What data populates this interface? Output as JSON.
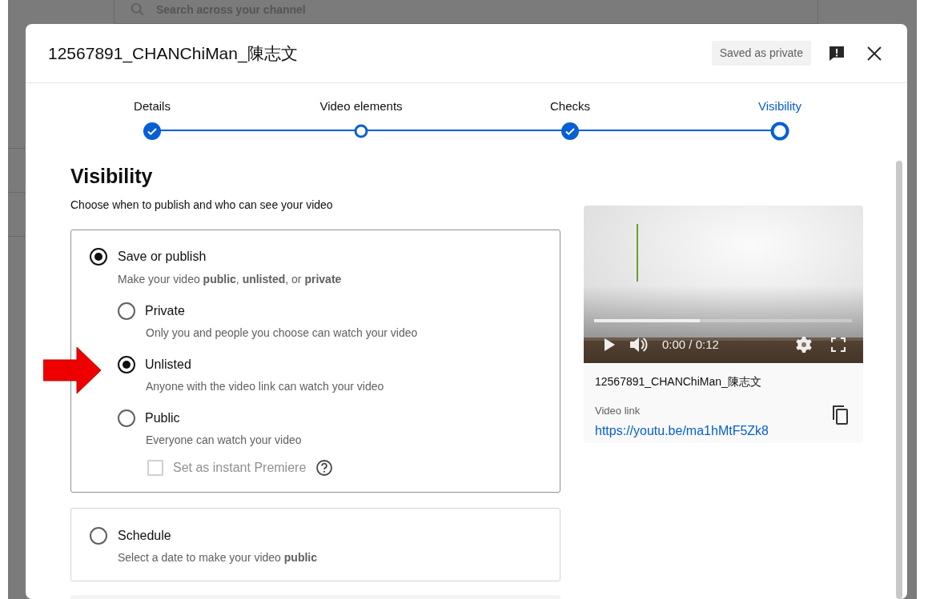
{
  "background": {
    "search_placeholder": "Search across your channel"
  },
  "dialog": {
    "title": "12567891_CHANChiMan_陳志文",
    "save_status": "Saved as private"
  },
  "steps": [
    {
      "label": "Details",
      "completed": true,
      "selected": false
    },
    {
      "label": "Video elements",
      "completed": false,
      "selected": false
    },
    {
      "label": "Checks",
      "completed": true,
      "selected": false
    },
    {
      "label": "Visibility",
      "completed": false,
      "selected": true
    }
  ],
  "visibility": {
    "heading": "Visibility",
    "description": "Choose when to publish and who can see your video",
    "save_or_publish": {
      "label": "Save or publish",
      "description": "Make your video **public**, **unlisted**, or **private**",
      "selected": true,
      "options": [
        {
          "label": "Private",
          "description": "Only you and people you choose can watch your video",
          "selected": false
        },
        {
          "label": "Unlisted",
          "description": "Anyone with the video link can watch your video",
          "selected": true
        },
        {
          "label": "Public",
          "description": "Everyone can watch your video",
          "selected": false
        }
      ],
      "premiere": {
        "label": "Set as instant Premiere",
        "checked": false,
        "disabled": true
      }
    },
    "schedule": {
      "label": "Schedule",
      "description": "Select a date to make your video **public**",
      "selected": false
    }
  },
  "annotations": [
    {
      "kind": "arrow"
    }
  ],
  "preview": {
    "player": {
      "time": "0:00 / 0:12",
      "level": 0.41
    },
    "filename": "12567891_CHANChiMan_陳志文",
    "link_label": "Video link",
    "link": "https://youtu.be/ma1hMtF5Zk8"
  }
}
